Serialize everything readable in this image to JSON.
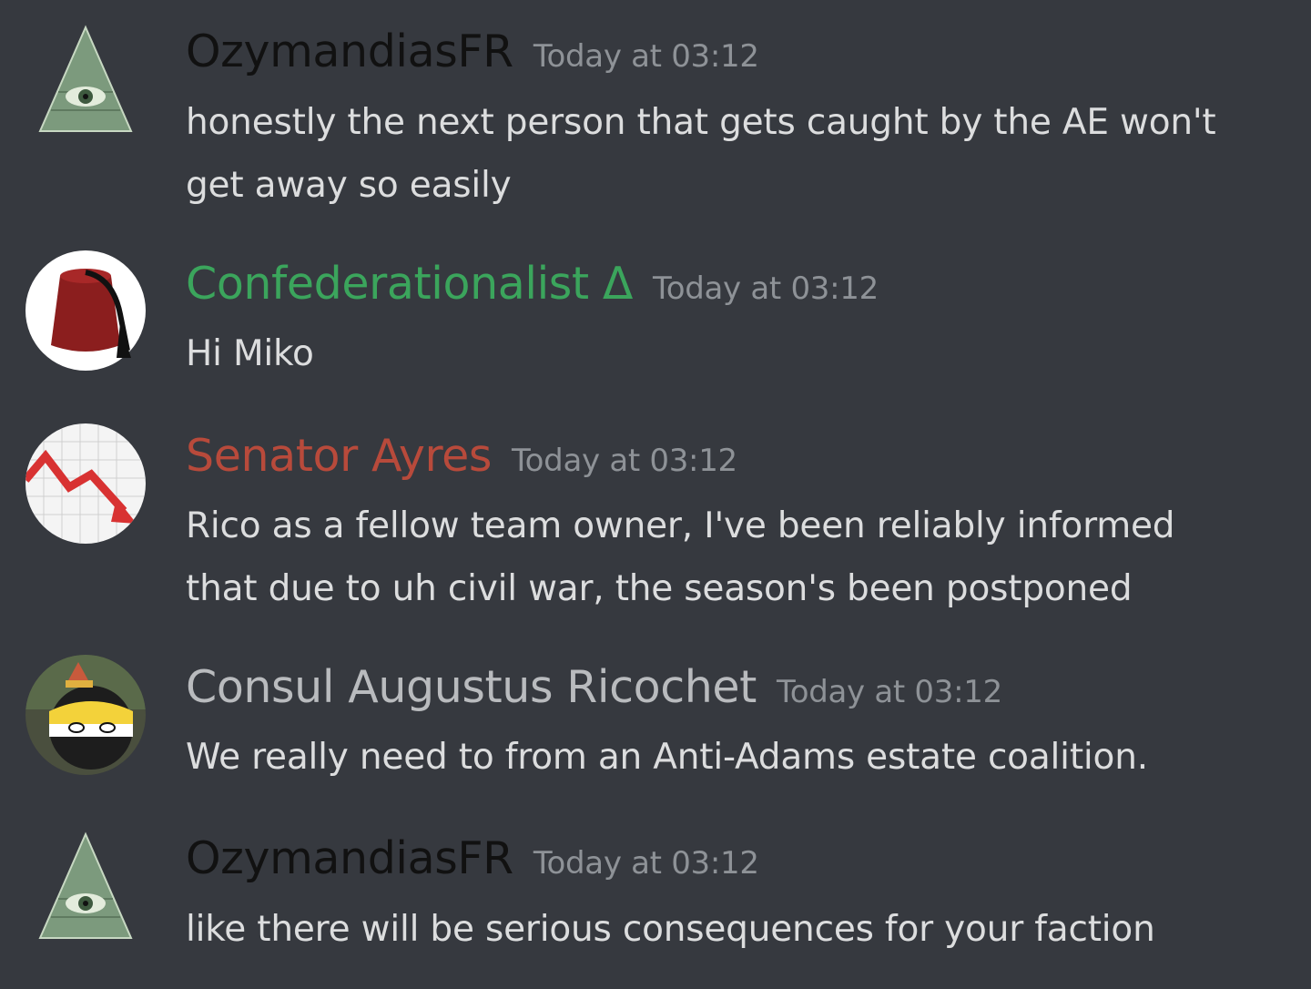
{
  "messages": [
    {
      "author": "OzymandiasFR",
      "author_color": "#111111",
      "timestamp": "Today at 03:12",
      "avatar": "illuminati-pyramid-icon",
      "lines": [
        "honestly the next person that gets caught by the AE won't",
        "get away so easily"
      ]
    },
    {
      "author": "Confederationalist Δ",
      "author_color": "#3ba55c",
      "timestamp": "Today at 03:12",
      "avatar": "fez-hat-icon",
      "lines": [
        "Hi Miko"
      ]
    },
    {
      "author": "Senator Ayres",
      "author_color": "#b84a3b",
      "timestamp": "Today at 03:12",
      "avatar": "falling-chart-icon",
      "lines": [
        "Rico as a fellow team owner, I've been reliably informed",
        "that due to uh civil war, the season's been postponed"
      ]
    },
    {
      "author": "Consul Augustus Ricochet",
      "author_color": "#b9bbbe",
      "timestamp": "Today at 03:12",
      "avatar": "countryball-icon",
      "lines": [
        "We really need to from an Anti-Adams estate coalition."
      ]
    },
    {
      "author": "OzymandiasFR",
      "author_color": "#111111",
      "timestamp": "Today at 03:12",
      "avatar": "illuminati-pyramid-icon",
      "lines": [
        "like there will be serious consequences for your faction"
      ]
    }
  ]
}
